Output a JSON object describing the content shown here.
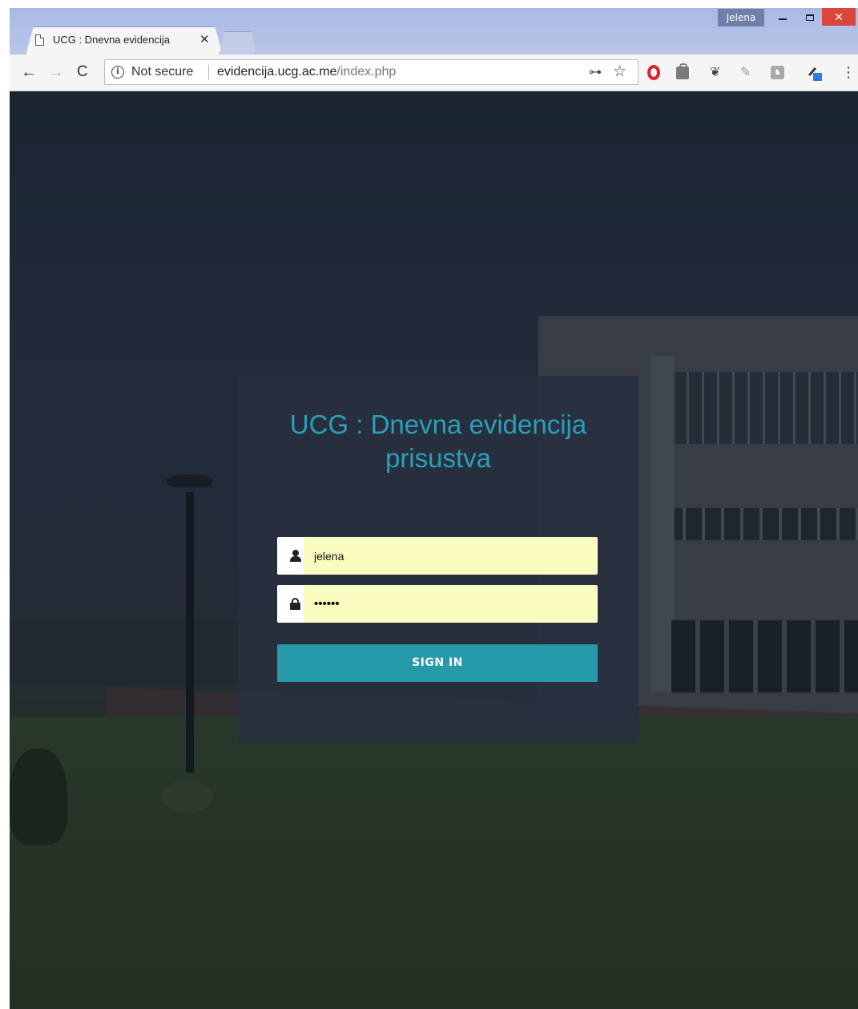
{
  "window": {
    "profile_name": "Jelena",
    "minimize_glyph": "",
    "close_glyph": "✕"
  },
  "tab": {
    "title": "UCG : Dnevna evidencija",
    "close_glyph": "✕",
    "icon": "page-icon"
  },
  "toolbar": {
    "back_glyph": "←",
    "forward_glyph": "→",
    "reload_glyph": "C",
    "security_label": "Not secure",
    "url_host": "evidencija.ucg.ac.me",
    "url_path": "/index.php",
    "key_glyph": "🔑",
    "star_glyph": "☆",
    "menu_glyph": "⋮",
    "extensions": [
      "opera-icon",
      "shopping-bag-icon",
      "evernote-icon",
      "pen-icon",
      "extension-box-icon",
      "color-picker-icon"
    ]
  },
  "login": {
    "title": "UCG : Dnevna evidencija prisustva",
    "username_value": "jelena",
    "password_value": "••••••",
    "sign_in_label": "SIGN IN"
  },
  "colors": {
    "accent": "#269aa8",
    "title": "#2aa0b8",
    "autofill": "#fafcc0",
    "close_button": "#d9463b"
  }
}
